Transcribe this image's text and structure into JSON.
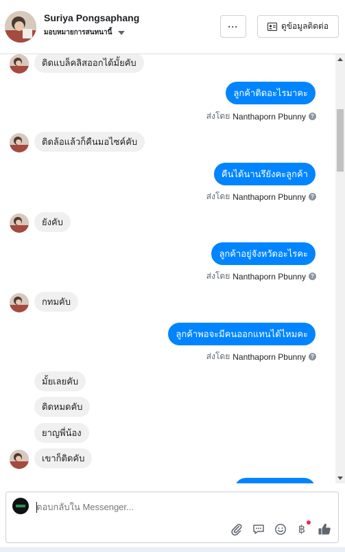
{
  "header": {
    "name": "Suriya Pongsaphang",
    "assign_label": "มอบหมายการสนทนานี้",
    "more_label": "···",
    "info_label": "ดูข้อมูลติดต่อ"
  },
  "messages": {
    "in": [
      "ติดแบล็คลิสออกได้มั้ยคับ",
      "ติดล้อแล้วก็คืนมอไซค์คับ",
      "ยังคับ",
      "กทมคับ",
      "มั้ยเลยคับ",
      "ติดหมดคับ",
      "ยาญพี่น้อง",
      "เขาก็ติดคับ"
    ],
    "out": [
      "ลูกค้าติดอะไรมาคะ",
      "คืนได้นานรึยังคะลูกค้า",
      "ลูกค้าอยู่จังหวัดอะไรคะ",
      "ลูกค้าพอจะมีคนออกแทนได้ไหมคะ"
    ],
    "sent_by_prefix": "ส่งโดย",
    "sent_by_name": "Nanthaporn Pbunny"
  },
  "composer": {
    "placeholder": "ตอบกลับใน Messenger..."
  },
  "icons": [
    "paperclip-icon",
    "chat-bubble-icon",
    "smile-icon",
    "baht-icon",
    "thumbs-up-icon",
    "question-icon",
    "contact-card-icon"
  ],
  "colors": {
    "accent": "#0084ff",
    "incoming_bg": "#f1f0f0",
    "notification_dot": "#f02849"
  }
}
